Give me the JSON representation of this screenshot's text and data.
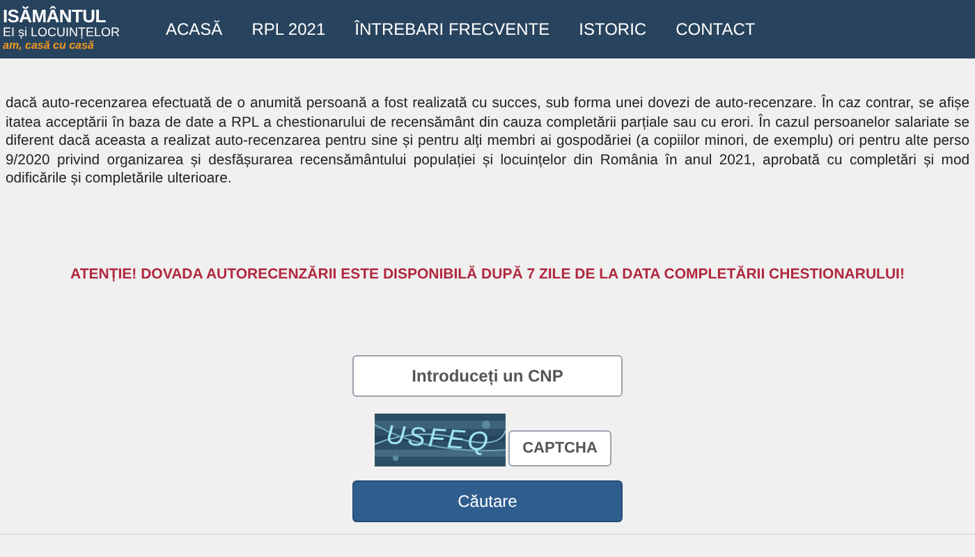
{
  "header": {
    "logo": {
      "line_1": "ISĂMÂNTUL",
      "line_2": "EI și LOCUINȚELOR",
      "line_3": "am, casă cu casă"
    },
    "nav": [
      {
        "label": "ACASĂ"
      },
      {
        "label": "RPL 2021"
      },
      {
        "label": "ÎNTREBARI FRECVENTE"
      },
      {
        "label": "ISTORIC"
      },
      {
        "label": "CONTACT"
      }
    ]
  },
  "paragraph_lines": [
    "dacă auto-recenzarea efectuată de o anumită persoană a fost realizată cu succes, sub forma unei dovezi de auto-recenzare. În caz contrar, se afișe",
    "itatea acceptării în baza de date a RPL a chestionarului de recensământ din cauza completării parțiale sau cu erori. În cazul persoanelor salariate se",
    "diferent dacă aceasta a realizat auto-recenzarea pentru sine și pentru alți membri ai gospodăriei (a copiilor minori, de exemplu) ori pentru alte perso",
    "9/2020 privind organizarea și desfășurarea recensământului populației și locuințelor din România în anul 2021, aprobată cu completări și mod",
    "odificările și completările ulterioare."
  ],
  "alert": "ATENȚIE! DOVADA AUTORECENZĂRII ESTE DISPONIBILĂ DUPĂ 7 ZILE DE LA DATA COMPLETĂRII CHESTIONARULUI!",
  "form": {
    "cnp_field": {
      "placeholder": "Introduceți un CNP"
    },
    "captcha_image": {
      "text": "USFEQ"
    },
    "captcha_field": {
      "placeholder": "CAPTCHA"
    },
    "search_button": "Căutare"
  }
}
